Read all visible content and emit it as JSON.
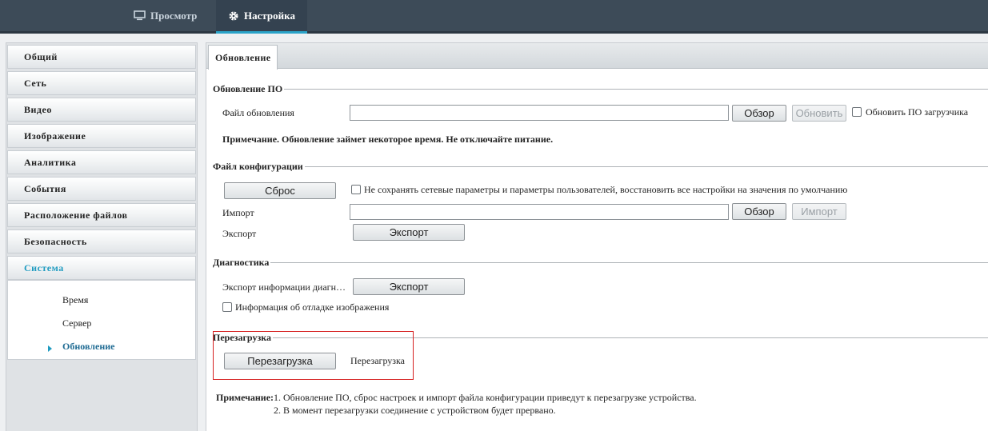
{
  "topbar": {
    "view_label": "Просмотр",
    "settings_label": "Настройка"
  },
  "sidebar": {
    "items": [
      {
        "label": "Общий"
      },
      {
        "label": "Сеть"
      },
      {
        "label": "Видео"
      },
      {
        "label": "Изображение"
      },
      {
        "label": "Аналитика"
      },
      {
        "label": "События"
      },
      {
        "label": "Расположение файлов"
      },
      {
        "label": "Безопасность"
      },
      {
        "label": "Система"
      }
    ],
    "sub_items": [
      {
        "label": "Время"
      },
      {
        "label": "Сервер"
      },
      {
        "label": "Обновление"
      }
    ]
  },
  "main": {
    "tab_label": "Обновление",
    "firmware": {
      "legend": "Обновление ПО",
      "file_label": "Файл обновления",
      "file_value": "",
      "browse_label": "Обзор",
      "update_label": "Обновить",
      "bootloader_label": "Обновить ПО загрузчика",
      "note": "Примечание. Обновление займет некоторое время. Не отключайте питание."
    },
    "config": {
      "legend": "Файл конфигурации",
      "reset_label": "Сброс",
      "keep_network_label": "Не сохранять сетевые параметры и параметры пользователей, восстановить все настройки на значения по умолчанию",
      "import_label": "Импорт",
      "import_value": "",
      "browse_label": "Обзор",
      "import_button_label": "Импорт",
      "export_label": "Экспорт",
      "export_button_label": "Экспорт"
    },
    "diagnostics": {
      "legend": "Диагностика",
      "export_info_label": "Экспорт информации диагн…",
      "export_button_label": "Экспорт",
      "image_debug_label": "Информация об отладке изображения"
    },
    "reboot": {
      "legend": "Перезагрузка",
      "button_label": "Перезагрузка",
      "text": "Перезагрузка"
    },
    "footer_note": {
      "title": "Примечание:",
      "line1": "1. Обновление ПО, сброс настроек и импорт файла конфигурации приведут к перезагрузке устройства.",
      "line2": "2. В момент перезагрузки соединение с устройством будет прервано."
    }
  },
  "colors": {
    "accent": "#1f9bc0",
    "topbar": "#3d4b58",
    "highlight": "#d51f1f"
  }
}
